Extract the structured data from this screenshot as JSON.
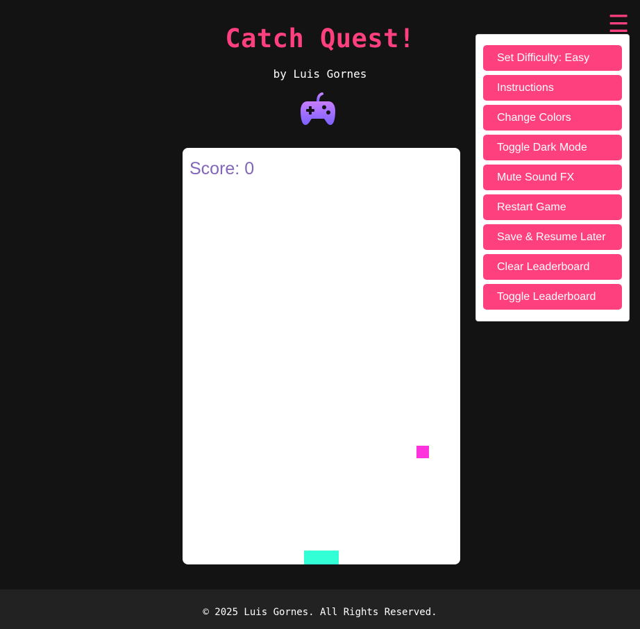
{
  "header": {
    "title": "Catch Quest!",
    "byline": "by Luis Gornes",
    "gamepad_icon": "gamepad-icon"
  },
  "game": {
    "score_label": "Score: 0",
    "score": 0,
    "falling_item_icon": "square-block"
  },
  "menu": {
    "toggle_glyph": "☰",
    "toggle_icon": "hamburger-menu-icon",
    "items": [
      {
        "label": "Set Difficulty: Easy"
      },
      {
        "label": "Instructions"
      },
      {
        "label": "Change Colors"
      },
      {
        "label": "Toggle Dark Mode"
      },
      {
        "label": "Mute Sound FX"
      },
      {
        "label": "Restart Game"
      },
      {
        "label": "Save & Resume Later"
      },
      {
        "label": "Clear Leaderboard"
      },
      {
        "label": "Toggle Leaderboard"
      }
    ]
  },
  "footer": {
    "text": "© 2025 Luis Gornes. All Rights Reserved."
  },
  "colors": {
    "background": "#131313",
    "accent": "#ff407f",
    "score_text": "#8266b8",
    "falling_item": "#ff33dd",
    "paddle": "#33ffd6",
    "footer_bg": "#222222",
    "gamepad_top": "#c77dff",
    "gamepad_bottom": "#7b61ff"
  }
}
